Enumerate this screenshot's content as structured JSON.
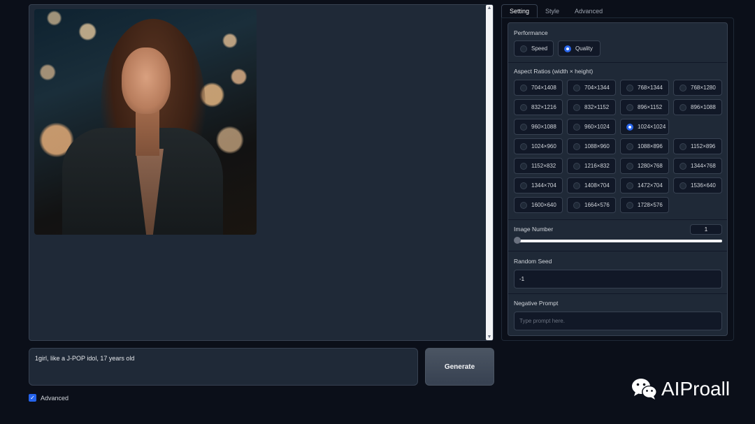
{
  "gallery": {
    "image_alt": "portrait of a young woman with bokeh lights"
  },
  "prompt": {
    "value": "1girl, like a J-POP idol, 17 years old"
  },
  "generate_label": "Generate",
  "advanced_check": {
    "label": "Advanced",
    "checked": true
  },
  "tabs": [
    {
      "label": "Setting",
      "active": true
    },
    {
      "label": "Style",
      "active": false
    },
    {
      "label": "Advanced",
      "active": false
    }
  ],
  "performance": {
    "label": "Performance",
    "options": [
      {
        "label": "Speed",
        "selected": false
      },
      {
        "label": "Quality",
        "selected": true
      }
    ]
  },
  "aspect_ratios": {
    "label": "Aspect Ratios (width × height)",
    "options": [
      "704×1408",
      "704×1344",
      "768×1344",
      "768×1280",
      "832×1216",
      "832×1152",
      "896×1152",
      "896×1088",
      "960×1088",
      "960×1024",
      "1024×1024",
      "1024×960",
      "1088×960",
      "1088×896",
      "1152×896",
      "1152×832",
      "1216×832",
      "1280×768",
      "1344×768",
      "1344×704",
      "1408×704",
      "1472×704",
      "1536×640",
      "1600×640",
      "1664×576",
      "1728×576"
    ],
    "selected": "1024×1024"
  },
  "image_number": {
    "label": "Image Number",
    "value": "1",
    "slider_fraction": 0
  },
  "random_seed": {
    "label": "Random Seed",
    "value": "-1"
  },
  "negative_prompt": {
    "label": "Negative Prompt",
    "placeholder": "Type prompt here."
  },
  "watermark": {
    "text": "AIProall",
    "icon": "wechat-icon"
  },
  "colors": {
    "accent": "#2563eb",
    "panel": "#1f2937",
    "background": "#0b0f19"
  }
}
